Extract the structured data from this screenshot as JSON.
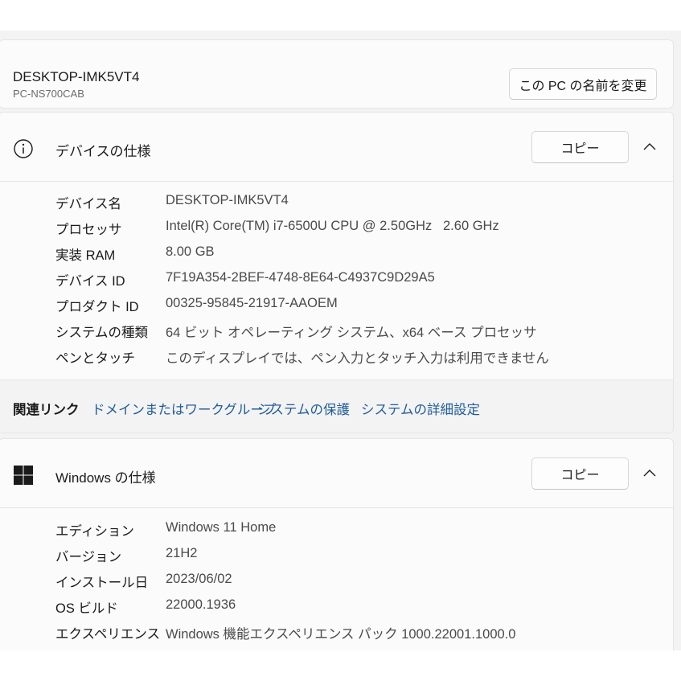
{
  "pc": {
    "name": "DESKTOP-IMK5VT4",
    "model": "PC-NS700CAB",
    "rename_button": "この PC の名前を変更"
  },
  "device_specs": {
    "title": "デバイスの仕様",
    "icon": "info-icon",
    "copy_button": "コピー",
    "rows": [
      {
        "label": "デバイス名",
        "value": "DESKTOP-IMK5VT4"
      },
      {
        "label": "プロセッサ",
        "value": "Intel(R) Core(TM) i7-6500U CPU @ 2.50GHz   2.60 GHz"
      },
      {
        "label": "実装 RAM",
        "value": "8.00 GB"
      },
      {
        "label": "デバイス ID",
        "value": "7F19A354-2BEF-4748-8E64-C4937C9D29A5"
      },
      {
        "label": "プロダクト ID",
        "value": "00325-95845-21917-AAOEM"
      },
      {
        "label": "システムの種類",
        "value": "64 ビット オペレーティング システム、x64 ベース プロセッサ"
      },
      {
        "label": "ペンとタッチ",
        "value": "このディスプレイでは、ペン入力とタッチ入力は利用できません"
      }
    ]
  },
  "related_links": {
    "label": "関連リンク",
    "links": [
      "ドメインまたはワークグループ",
      "システムの保護",
      "システムの詳細設定"
    ]
  },
  "windows_specs": {
    "title": "Windows の仕様",
    "icon": "windows-logo-icon",
    "copy_button": "コピー",
    "rows": [
      {
        "label": "エディション",
        "value": "Windows 11 Home"
      },
      {
        "label": "バージョン",
        "value": "21H2"
      },
      {
        "label": "インストール日",
        "value": "2023/06/02"
      },
      {
        "label": "OS ビルド",
        "value": "22000.1936"
      },
      {
        "label": "エクスペリエンス",
        "value": "Windows 機能エクスペリエンス パック 1000.22001.1000.0"
      }
    ]
  },
  "colors": {
    "link": "#1f5c99",
    "page_bg": "#f3f3f3",
    "card_bg": "#fbfbfb"
  }
}
